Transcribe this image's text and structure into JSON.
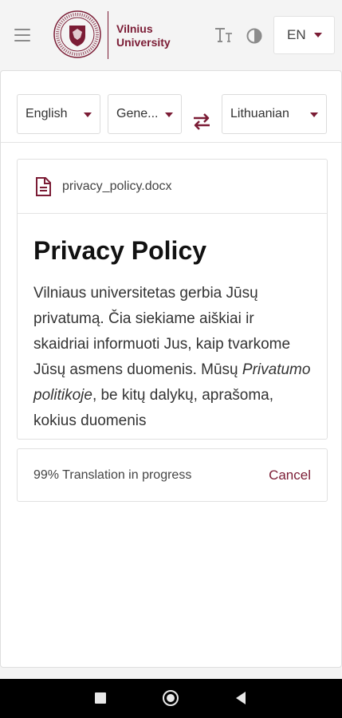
{
  "header": {
    "brand_line1": "Vilnius",
    "brand_line2": "University",
    "logo_icon": "university-seal-icon",
    "menu_icon": "hamburger-menu-icon",
    "text_size_icon": "text-size-icon",
    "contrast_icon": "contrast-icon",
    "language": "EN"
  },
  "toolbar": {
    "source_language": "English",
    "domain": "Gene...",
    "target_language": "Lithuanian",
    "swap_icon": "swap-arrows-icon"
  },
  "document": {
    "file_icon": "document-file-icon",
    "file_name": "privacy_policy.docx",
    "title": "Privacy Policy",
    "text_part1": "Vilniaus universitetas gerbia Jūsų privatumą. Čia siekiame aiškiai ir skaidriai informuoti Jus, kaip tvarkome Jūsų asmens duomenis. Mūsų ",
    "text_emph": "Privatumo politikoje",
    "text_part2": ", be kitų dalykų, aprašoma, kokius duomenis"
  },
  "progress": {
    "percent": 99,
    "status_text": "99% Translation in progress",
    "cancel_label": "Cancel"
  },
  "system_nav": {
    "recents_icon": "recents-square-icon",
    "home_icon": "home-circle-icon",
    "back_icon": "back-triangle-icon"
  },
  "colors": {
    "accent": "#7b1c35",
    "background": "#f4f4f4",
    "card": "#ffffff",
    "navbar": "#000000"
  }
}
